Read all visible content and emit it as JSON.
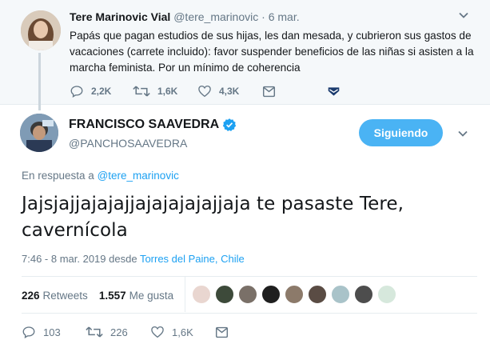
{
  "parent_tweet": {
    "author_name": "Tere Marinovic Vial",
    "author_handle": "@tere_marinovic",
    "separator": "·",
    "date": "6 mar.",
    "text": "Papás que pagan estudios de sus hijas, les dan mesada, y cubrieron sus gastos de vacaciones (carrete incluido): favor suspender beneficios de las niñas si asisten a la marcha feminista. Por un mínimo de coherencia",
    "replies": "2,2K",
    "retweets": "1,6K",
    "likes": "4,3K"
  },
  "main_tweet": {
    "author_name": "FRANCISCO SAAVEDRA",
    "author_handle": "@PANCHOSAAVEDRA",
    "follow_label": "Siguiendo",
    "reply_prefix": "En respuesta a",
    "reply_handle": "@tere_marinovic",
    "text": "Jajsjajjajajajjajajajajajjaja te pasaste Tere, cavernícola",
    "timestamp": "7:46 - 8 mar. 2019 desde",
    "location": "Torres del Paine, Chile",
    "retweet_count": "226",
    "retweet_label": "Retweets",
    "like_count": "1.557",
    "like_label": "Me gusta",
    "replies": "103",
    "retweets": "226",
    "likes": "1,6K"
  },
  "colors": {
    "accent": "#1da1f2",
    "follow_button": "#4ab3f4",
    "muted_text": "#657786",
    "verified": "#1da1f2",
    "dm_icon": "#1b3b6e"
  },
  "icons": [
    "chevron-down-icon",
    "reply-icon",
    "retweet-icon",
    "heart-icon",
    "mail-icon",
    "verified-icon"
  ]
}
